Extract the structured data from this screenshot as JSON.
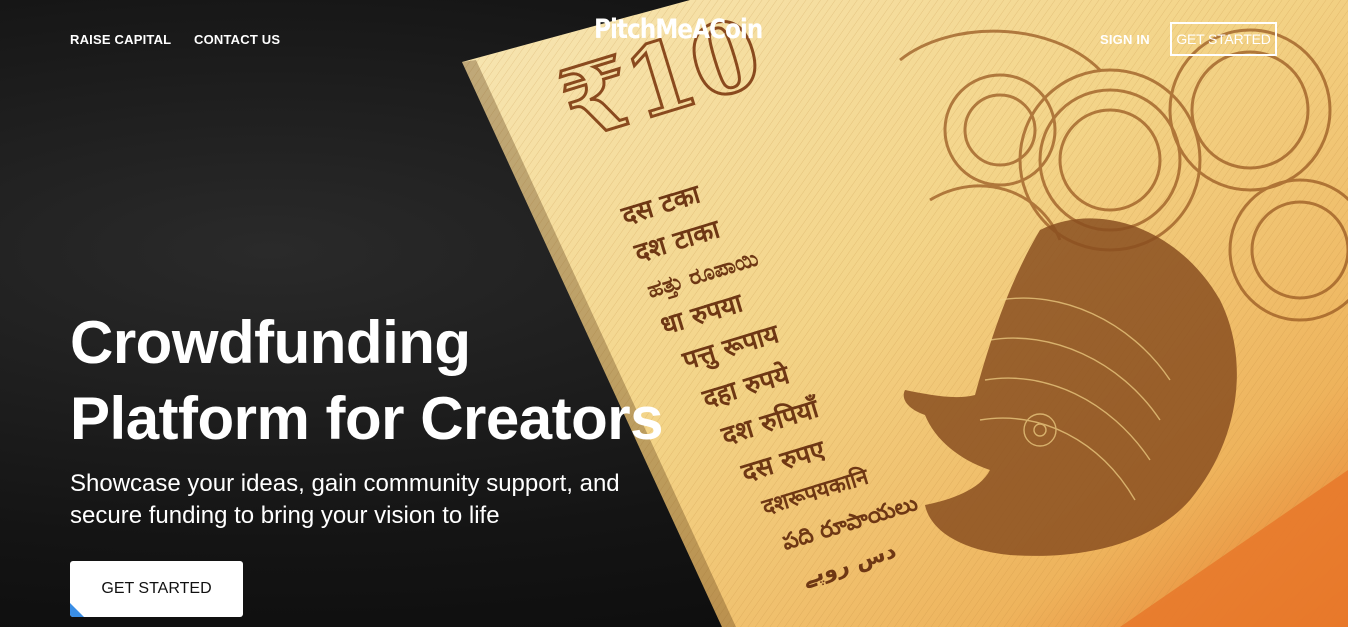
{
  "nav": {
    "left_links": [
      "RAISE CAPITAL",
      "CONTACT US"
    ],
    "brand": "PitchMeACoin",
    "sign_in": "SIGN IN",
    "get_started": "GET STARTED"
  },
  "hero": {
    "headline_line1": "Crowdfunding",
    "headline_line2": "Platform for Creators",
    "subtitle_line1": "Showcase your ideas, gain community support, and",
    "subtitle_line2": "secure funding to bring your vision to life",
    "cta": "GET STARTED"
  },
  "banknote": {
    "denomination": "₹10",
    "script_lines": [
      "दस टका",
      "दश टाका",
      "ಹತ್ತು ರೂಪಾಯಿ",
      "धा रुपया",
      "पत्तु रूपाय",
      "दहा रुपये",
      "दश रुपियाँ",
      "दस रुपए",
      "दशरूपयकानि",
      "పది రూపాయలు",
      "دس روپے"
    ],
    "colors": {
      "paper": "#f4d58a",
      "ink": "#8a4a1e",
      "orange": "#e87a2a"
    }
  }
}
